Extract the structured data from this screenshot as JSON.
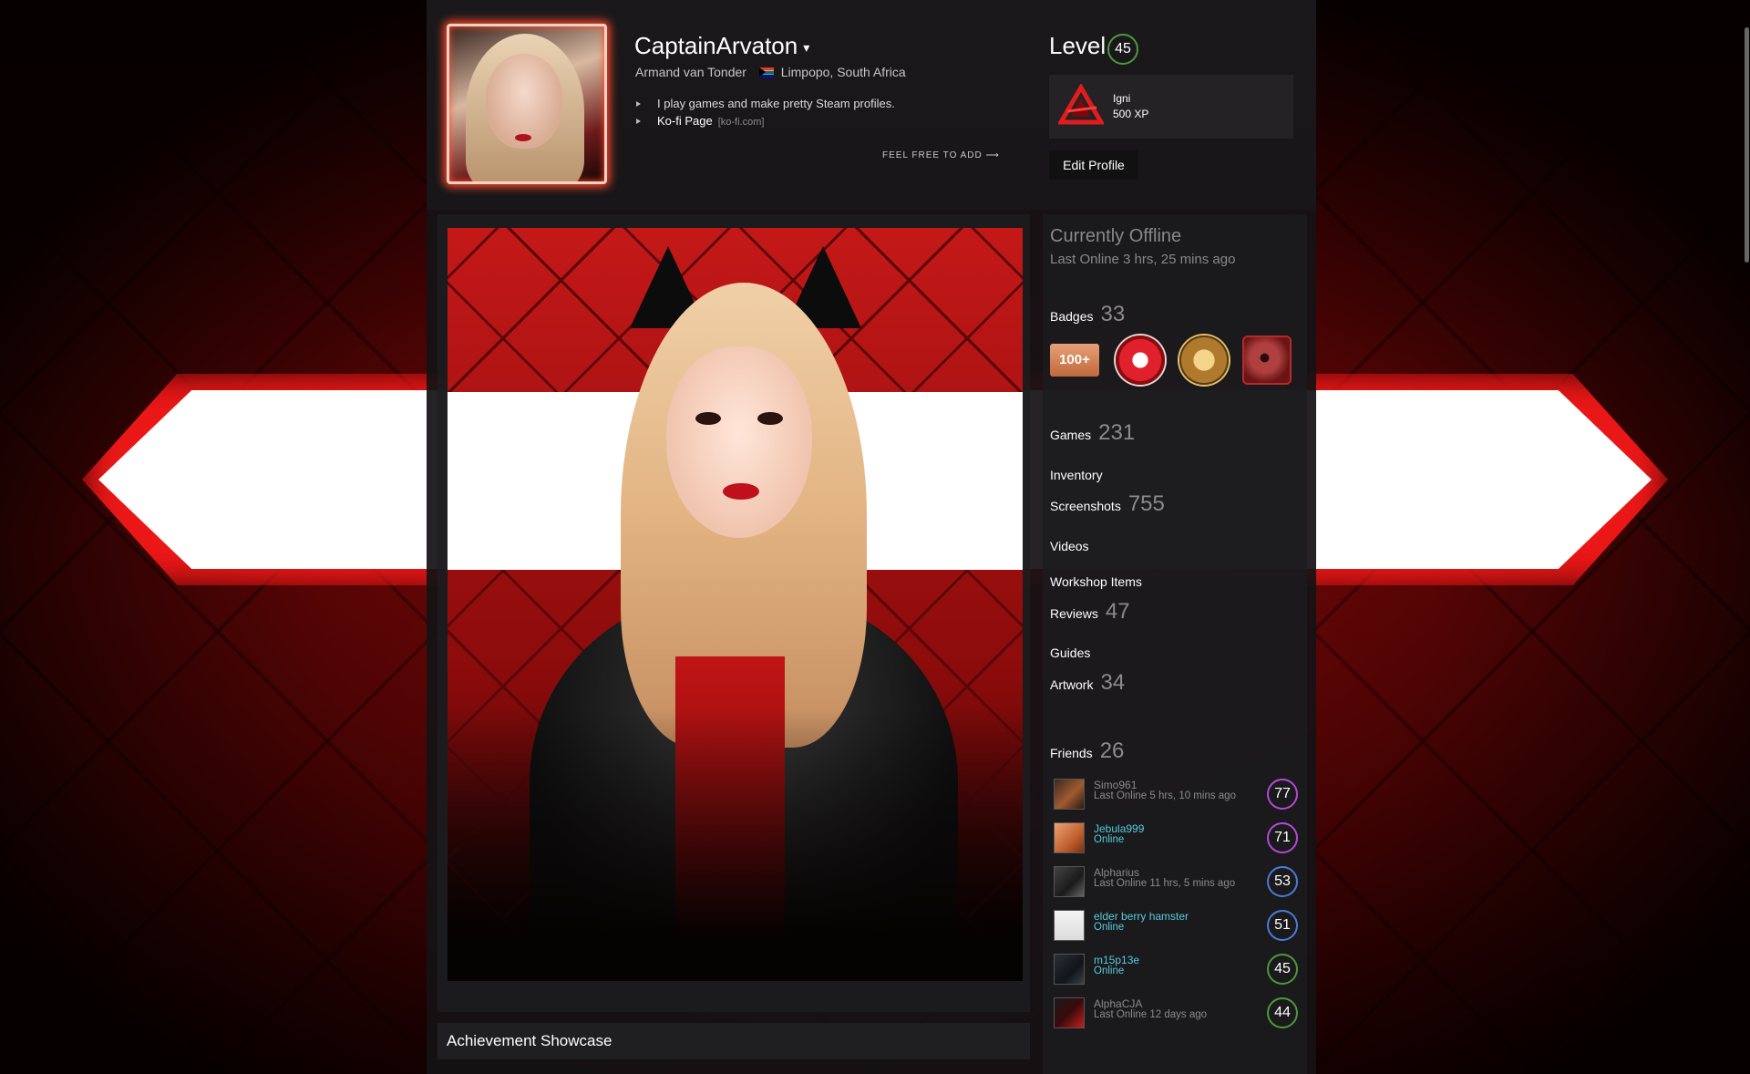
{
  "profile": {
    "persona_name": "CaptainArvaton",
    "real_name": "Armand van Tonder",
    "location": "Limpopo, South Africa",
    "summary_line1": "I play games and make pretty Steam profiles.",
    "summary_link_label": "Ko-fi Page",
    "summary_link_host": "[ko-fi.com]",
    "free_to_add": "FEEL FREE TO ADD ⟶"
  },
  "level": {
    "label": "Level",
    "value": "45",
    "color": "#4c9a3a",
    "xp_badge_name": "Igni",
    "xp_badge_xp": "500 XP",
    "edit_button": "Edit Profile"
  },
  "status": {
    "title": "Currently Offline",
    "last_online": "Last Online 3 hrs, 25 mins ago"
  },
  "counts": {
    "badges_label": "Badges",
    "badges_value": "33",
    "games_label": "Games",
    "games_value": "231",
    "inventory_label": "Inventory",
    "screenshots_label": "Screenshots",
    "screenshots_value": "755",
    "videos_label": "Videos",
    "workshop_label": "Workshop Items",
    "reviews_label": "Reviews",
    "reviews_value": "47",
    "guides_label": "Guides",
    "artwork_label": "Artwork",
    "artwork_value": "34",
    "friends_label": "Friends",
    "friends_value": "26"
  },
  "badges": {
    "first_badge_text": "100+",
    "icons": [
      "years-of-service-badge",
      "red-emblem-badge",
      "gold-seal-badge",
      "eye-artwork-badge"
    ]
  },
  "friends": [
    {
      "name": "Simo961",
      "status": "Last Online 5 hrs, 10 mins ago",
      "level": "77",
      "online": false,
      "ring": "#b548d8"
    },
    {
      "name": "Jebula999",
      "status": "Online",
      "level": "71",
      "online": true,
      "ring": "#b548d8"
    },
    {
      "name": "Alpharius",
      "status": "Last Online 11 hrs, 5 mins ago",
      "level": "53",
      "online": false,
      "ring": "#4a7bd8"
    },
    {
      "name": "elder berry hamster",
      "status": "Online",
      "level": "51",
      "online": true,
      "ring": "#4a7bd8"
    },
    {
      "name": "m15p13e",
      "status": "Online",
      "level": "45",
      "online": true,
      "ring": "#4c9a3a"
    },
    {
      "name": "AlphaCJA",
      "status": "Last Online 12 days ago",
      "level": "44",
      "online": false,
      "ring": "#4c9a3a"
    }
  ],
  "showcase": {
    "achievement_title": "Achievement Showcase"
  },
  "colors": {
    "accent_red": "#e01c1c",
    "online_blue": "#57cbde",
    "muted_gray": "#8b8b8b"
  }
}
